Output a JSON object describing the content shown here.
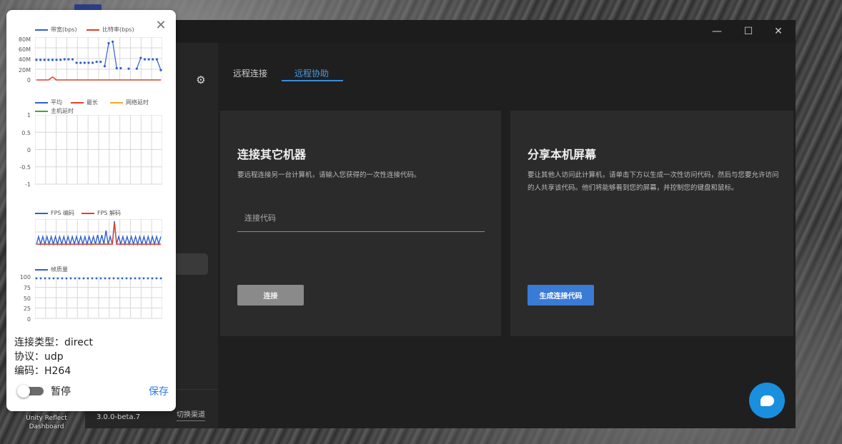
{
  "desktop": {
    "shortcut_label": "Unity Reflect Dashboard"
  },
  "window": {
    "controls": {
      "minimize": "—",
      "maximize": "☐",
      "close": "✕"
    },
    "sidebar": {
      "settings_icon": "gear-icon",
      "version": "3.0.0-beta.7",
      "switch_channel": "切换渠道"
    },
    "tabs": [
      {
        "label": "远程连接",
        "active": false
      },
      {
        "label": "远程协助",
        "active": true
      }
    ],
    "connect_card": {
      "title": "连接其它机器",
      "description": "要远程连接另一台计算机，请输入您获得的一次性连接代码。",
      "input_placeholder": "连接代码",
      "input_value": "",
      "button_label": "连接"
    },
    "share_card": {
      "title": "分享本机屏幕",
      "description": "要让其他人访问此计算机，请单击下方以生成一次性访问代码，然后与您要允许访问的人共享该代码。他们将能够看到您的屏幕，并控制您的键盘和鼠标。",
      "button_label": "生成连接代码"
    },
    "chat_icon": "chat-bubble-icon"
  },
  "stats_panel": {
    "close_icon": "close-icon",
    "colors": {
      "blue": "#2f5fd0",
      "red": "#e0402a",
      "orange": "#f5a623",
      "green": "#3aaa35"
    },
    "chart_data": [
      {
        "type": "line",
        "legend": [
          "带宽(bps)",
          "比特率(bps)"
        ],
        "ytick_labels": [
          "80M",
          "60M",
          "40M",
          "20M",
          "0"
        ],
        "ylim": [
          0,
          80
        ],
        "grid": true,
        "series": [
          {
            "name": "带宽(bps)",
            "color": "#2f5fd0",
            "style": "dotted",
            "values": [
              41,
              41,
              41,
              41,
              41,
              41,
              41,
              42,
              42,
              42,
              35,
              35,
              35,
              35,
              35,
              37,
              37,
              28,
              75,
              78,
              24,
              24,
              null,
              23,
              null,
              23,
              45,
              42,
              42,
              42,
              42,
              20
            ]
          },
          {
            "name": "比特率(bps)",
            "color": "#e0402a",
            "style": "solid",
            "values": [
              0,
              0,
              0,
              0,
              6,
              0,
              0,
              0,
              0,
              0,
              0,
              0,
              0,
              0,
              0,
              0,
              0,
              0,
              0,
              0,
              0,
              0,
              0,
              0,
              0,
              0,
              0,
              0,
              0,
              0,
              0,
              0
            ]
          }
        ]
      },
      {
        "type": "line",
        "legend": [
          "平均",
          "最长",
          "网络延时",
          "主机延时"
        ],
        "ytick_labels": [
          "1",
          "0.5",
          "0",
          "-0.5",
          "-1"
        ],
        "ylim": [
          -1,
          1
        ],
        "grid": true,
        "series": []
      },
      {
        "type": "line",
        "legend": [
          "FPS 编码",
          "FPS 解码"
        ],
        "grid": true,
        "series": [
          {
            "name": "FPS 编码",
            "color": "#2f5fd0",
            "values": [
              0,
              10,
              0,
              10,
              0,
              10,
              0,
              10,
              0,
              10,
              0,
              10,
              0,
              10,
              0,
              10,
              0,
              10,
              0,
              10,
              0,
              10,
              0,
              10,
              0,
              10,
              0,
              10,
              0,
              12,
              0,
              12,
              0,
              18,
              0,
              10,
              0,
              30,
              0,
              10,
              0,
              10,
              0,
              10,
              0,
              10,
              0,
              10,
              0,
              10,
              0,
              10,
              0,
              10,
              0,
              10,
              0,
              10,
              0,
              10
            ]
          },
          {
            "name": "FPS 解码",
            "color": "#e0402a",
            "values": [
              0,
              0,
              0,
              0,
              0,
              0,
              0,
              0,
              0,
              0,
              0,
              0,
              0,
              0,
              0,
              0,
              0,
              0,
              0,
              0,
              0,
              0,
              0,
              0,
              0,
              0,
              0,
              0,
              0,
              0,
              0,
              0,
              0,
              0,
              0,
              0,
              0,
              28,
              0,
              0,
              0,
              0,
              0,
              0,
              0,
              0,
              0,
              0,
              0,
              0,
              0,
              0,
              0,
              0,
              0,
              0,
              0,
              0,
              0,
              0
            ]
          }
        ]
      },
      {
        "type": "line",
        "legend": [
          "帧质量"
        ],
        "ytick_labels": [
          "100",
          "75",
          "50",
          "25",
          "0"
        ],
        "ylim": [
          0,
          100
        ],
        "grid": true,
        "series": [
          {
            "name": "帧质量",
            "color": "#2f5fd0",
            "style": "dotted",
            "values": [
              100,
              100,
              100,
              100,
              100,
              100,
              100,
              100,
              100,
              100,
              100,
              100,
              100,
              100,
              100,
              100,
              100,
              100,
              100,
              100,
              100,
              100,
              100,
              100,
              100,
              100,
              100,
              100,
              100,
              100
            ]
          }
        ]
      }
    ],
    "info": {
      "connection_type": "连接类型：direct",
      "protocol": "协议：udp",
      "codec": "编码：H264"
    },
    "pause_label": "暂停",
    "pause_toggle_on": false,
    "save_label": "保存"
  }
}
